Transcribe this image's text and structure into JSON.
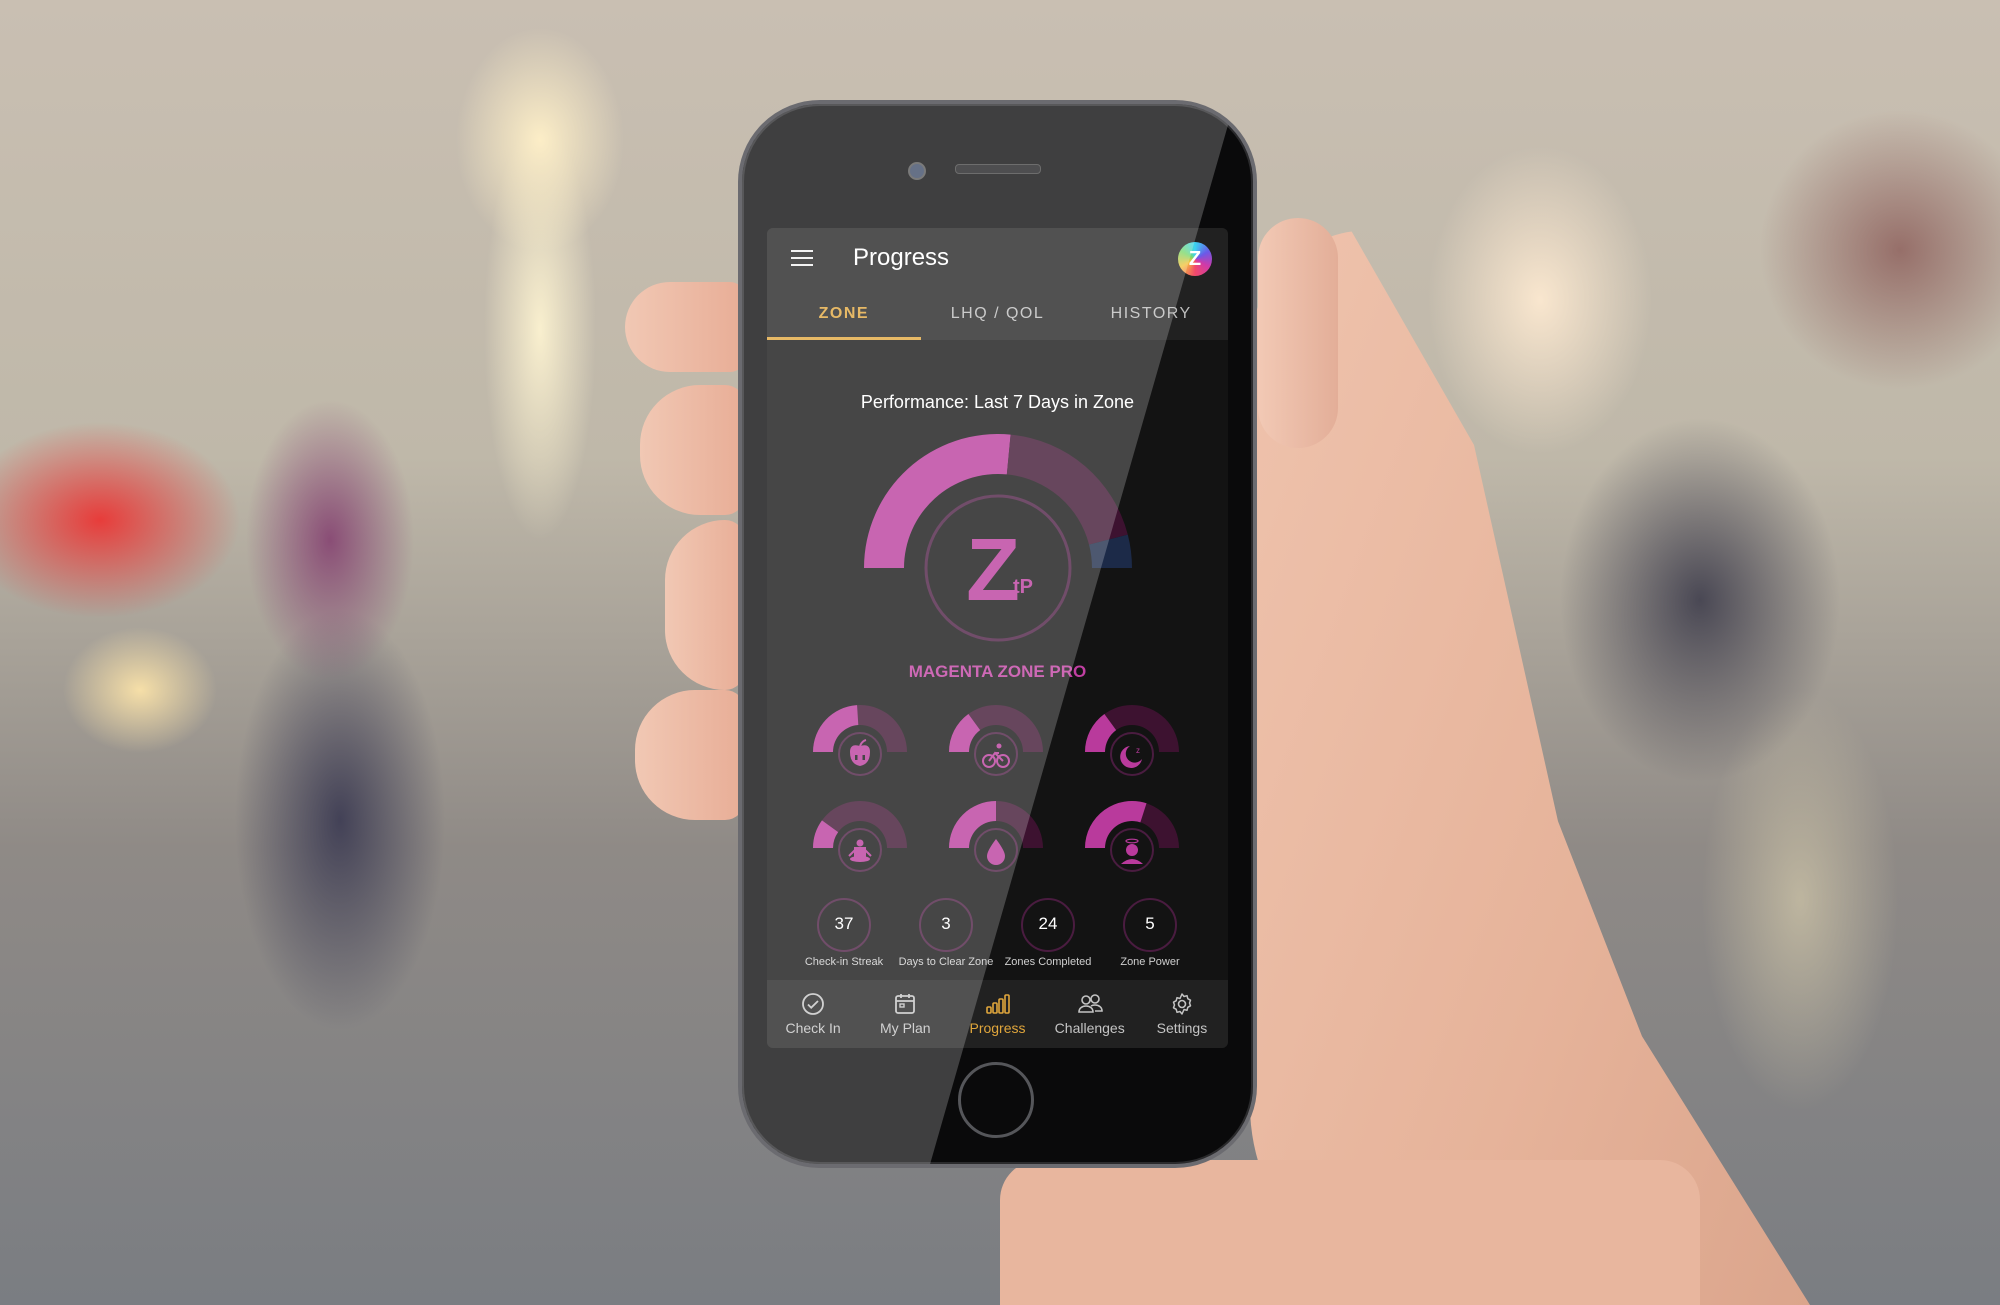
{
  "app": {
    "title": "Progress",
    "avatar_letter": "Z"
  },
  "tabs": [
    {
      "label": "ZONE",
      "active": true
    },
    {
      "label": "LHQ / QOL",
      "active": false
    },
    {
      "label": "HISTORY",
      "active": false
    }
  ],
  "performance": {
    "heading": "Performance: Last 7 Days in Zone",
    "zone_name": "MAGENTA ZONE PRO",
    "logo_text": "Z",
    "logo_sub": "tP",
    "segments": [
      {
        "name": "magenta",
        "fraction": 0.53,
        "color": "#b93a9c"
      },
      {
        "name": "dark-magenta",
        "fraction": 0.39,
        "color": "#3d1230"
      },
      {
        "name": "navy",
        "fraction": 0.08,
        "color": "#1c2a48"
      }
    ]
  },
  "categories": [
    {
      "name": "nutrition",
      "icon": "apple-icon",
      "progress": 0.48
    },
    {
      "name": "exercise",
      "icon": "bicycle-icon",
      "progress": 0.3
    },
    {
      "name": "sleep",
      "icon": "moon-icon",
      "progress": 0.3
    },
    {
      "name": "mindfulness",
      "icon": "meditation-icon",
      "progress": 0.2
    },
    {
      "name": "hydration",
      "icon": "water-drop-icon",
      "progress": 0.5
    },
    {
      "name": "wellbeing",
      "icon": "halo-person-icon",
      "progress": 0.6
    }
  ],
  "stats": [
    {
      "value": "37",
      "label": "Check-in Streak"
    },
    {
      "value": "3",
      "label": "Days to Clear Zone"
    },
    {
      "value": "24",
      "label": "Zones Completed"
    },
    {
      "value": "5",
      "label": "Zone Power"
    }
  ],
  "nav": [
    {
      "label": "Check In",
      "icon": "check-circle-icon",
      "active": false
    },
    {
      "label": "My Plan",
      "icon": "calendar-icon",
      "active": false
    },
    {
      "label": "Progress",
      "icon": "bar-chart-icon",
      "active": true
    },
    {
      "label": "Challenges",
      "icon": "people-icon",
      "active": false
    },
    {
      "label": "Settings",
      "icon": "gear-icon",
      "active": false
    }
  ],
  "colors": {
    "accent": "#e0a63c",
    "magenta": "#b93a9c",
    "dark_magenta": "#3d1230",
    "ring": "#4a1c40"
  }
}
